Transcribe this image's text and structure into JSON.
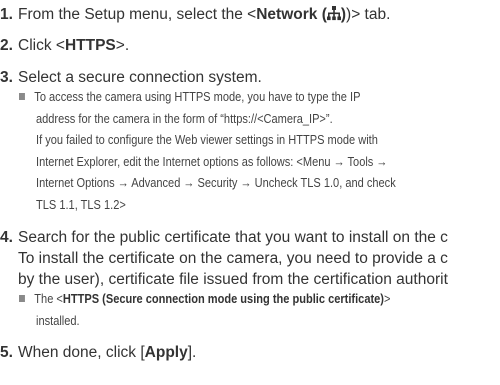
{
  "steps": [
    {
      "num": "1.",
      "pre": "From the Setup menu, select the <",
      "bold": "Network (",
      "post": ")> tab.",
      "icon": "network-icon"
    },
    {
      "num": "2.",
      "pre": "Click <",
      "bold": "HTTPS",
      "post": ">."
    },
    {
      "num": "3.",
      "text": "Select a secure connection system."
    },
    {
      "num": "4.",
      "line1": "Search for the public certificate that you want to install on the c",
      "line2": "To install the certificate on the camera, you need to provide a c",
      "line3": "by the user), certificate file issued from the certification authorit"
    },
    {
      "num": "5.",
      "pre": "When done, click [",
      "bold": "Apply",
      "post": "]."
    }
  ],
  "note3": {
    "lines": [
      "To access the camera using HTTPS mode, you have to type the IP",
      "address for the camera in the form of “https://<Camera_IP>”.",
      "If you failed to configure the Web viewer settings in HTTPS mode with",
      "Internet Explorer, edit the Internet options as follows: <Menu → Tools →",
      "Internet Options → Advanced → Security → Uncheck TLS 1.0, and check",
      "TLS 1.1, TLS 1.2>"
    ]
  },
  "note4": {
    "pre": "The <",
    "bold": "HTTPS (Secure connection mode using the public certificate)",
    "post": ">",
    "line2": "installed."
  }
}
